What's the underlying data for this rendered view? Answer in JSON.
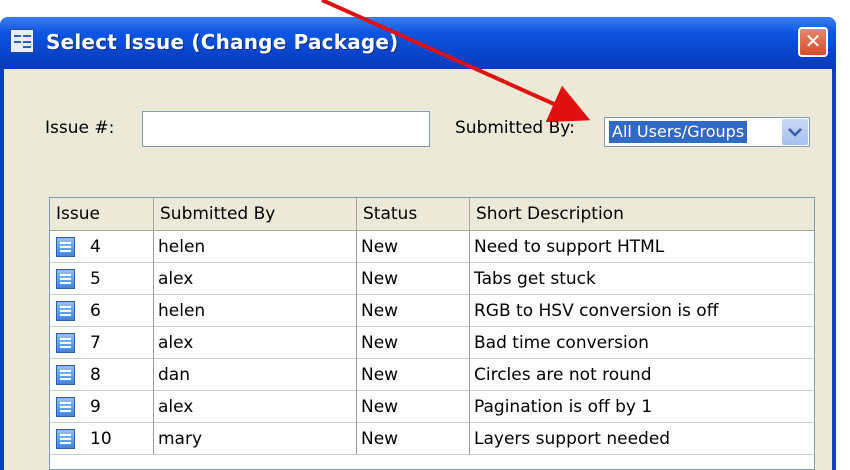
{
  "dialog": {
    "title": "Select Issue (Change Package)"
  },
  "filters": {
    "issue_label": "Issue #:",
    "issue_value": "",
    "submitted_by_label": "Submitted By:",
    "submitted_by_value": "All Users/Groups"
  },
  "table": {
    "columns": [
      "Issue",
      "Submitted By",
      "Status",
      "Short Description"
    ],
    "rows": [
      {
        "issue": "4",
        "submitted_by": "helen",
        "status": "New",
        "description": "Need to support HTML"
      },
      {
        "issue": "5",
        "submitted_by": "alex",
        "status": "New",
        "description": "Tabs get stuck"
      },
      {
        "issue": "6",
        "submitted_by": "helen",
        "status": "New",
        "description": "RGB to HSV conversion is off"
      },
      {
        "issue": "7",
        "submitted_by": "alex",
        "status": "New",
        "description": "Bad time conversion"
      },
      {
        "issue": "8",
        "submitted_by": "dan",
        "status": "New",
        "description": "Circles are not round"
      },
      {
        "issue": "9",
        "submitted_by": "alex",
        "status": "New",
        "description": "Pagination is off by 1"
      },
      {
        "issue": "10",
        "submitted_by": "mary",
        "status": "New",
        "description": "Layers support needed"
      }
    ]
  },
  "colors": {
    "titlebar": "#0842c8",
    "annotation_arrow": "#e01010",
    "selection": "#316ac5"
  },
  "icons": [
    "app-icon",
    "close-icon",
    "dropdown-arrow-icon",
    "issue-icon",
    "annotation-arrow"
  ]
}
